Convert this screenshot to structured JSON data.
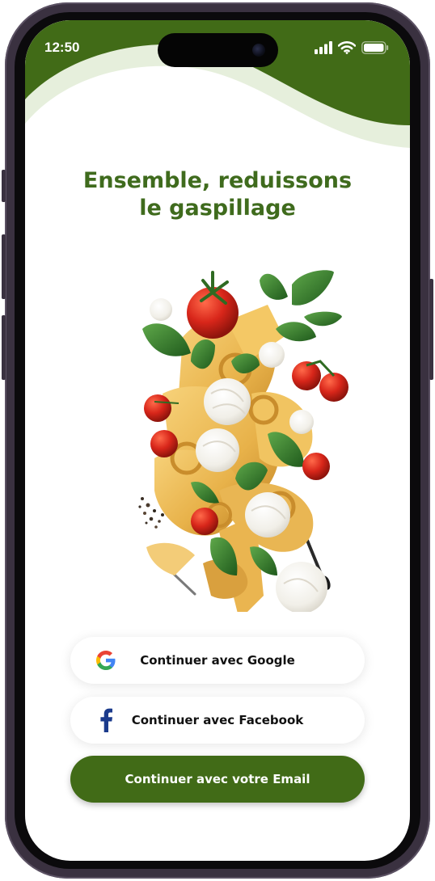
{
  "status_bar": {
    "time": "12:50"
  },
  "headline": {
    "line1": "Ensemble, reduissons",
    "line2": "le gaspillage"
  },
  "buttons": {
    "google": "Continuer avec Google",
    "facebook": "Continuer avec Facebook",
    "email": "Continuer avec votre Email"
  },
  "colors": {
    "brand_green": "#416b17",
    "header_light": "#e6efdc",
    "title_green": "#3f6b1d",
    "facebook_blue": "#1b3b8c"
  },
  "icons": {
    "google": "google-g-icon",
    "facebook": "facebook-f-icon",
    "signal": "cellular-signal-icon",
    "wifi": "wifi-icon",
    "battery": "battery-icon"
  }
}
